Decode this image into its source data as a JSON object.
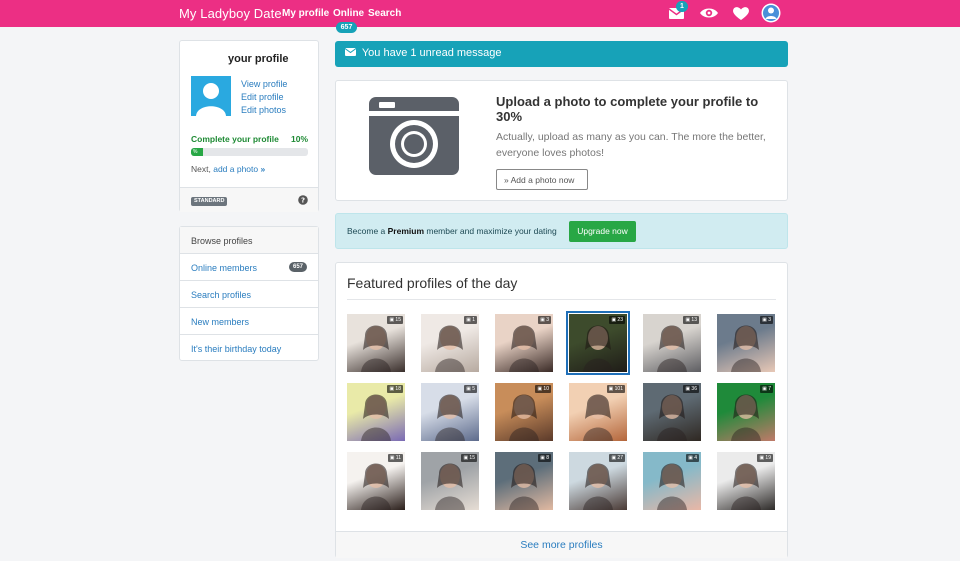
{
  "nav": {
    "brand": "My Ladyboy Date",
    "my_profile": "My profile",
    "online": "Online",
    "online_count": "657",
    "search": "Search",
    "mail_count": "1",
    "accent": "#ec2f84"
  },
  "profile": {
    "title": "your profile",
    "view": "View profile",
    "edit": "Edit profile",
    "photos": "Edit photos",
    "complete_label": "Complete your profile",
    "complete_pct": "10%",
    "progress_fraction": 0.1,
    "progress_inner": "%",
    "next_prefix": "Next,",
    "next_link": "add a photo",
    "membership": "STANDARD"
  },
  "browse": {
    "header": "Browse profiles",
    "items": [
      "Online members",
      "Search profiles",
      "New members",
      "It's their birthday today"
    ],
    "online_count": "657"
  },
  "alert": {
    "text": "You have 1 unread message"
  },
  "upload": {
    "title": "Upload a photo to complete your profile to 30%",
    "desc": "Actually, upload as many as you can. The more the better, everyone loves photos!",
    "button": "Add a photo now"
  },
  "premium": {
    "prefix": "Become a ",
    "bold": "Premium",
    "suffix": " member and maximize your dating",
    "button": "Upgrade now"
  },
  "featured": {
    "title": "Featured profiles of the day",
    "photo_counts": [
      "15",
      "1",
      "3",
      "23",
      "13",
      "3",
      "18",
      "5",
      "10",
      "101",
      "36",
      "7",
      "11",
      "15",
      "8",
      "27",
      "4",
      "19"
    ],
    "see_more": "See more profiles"
  }
}
